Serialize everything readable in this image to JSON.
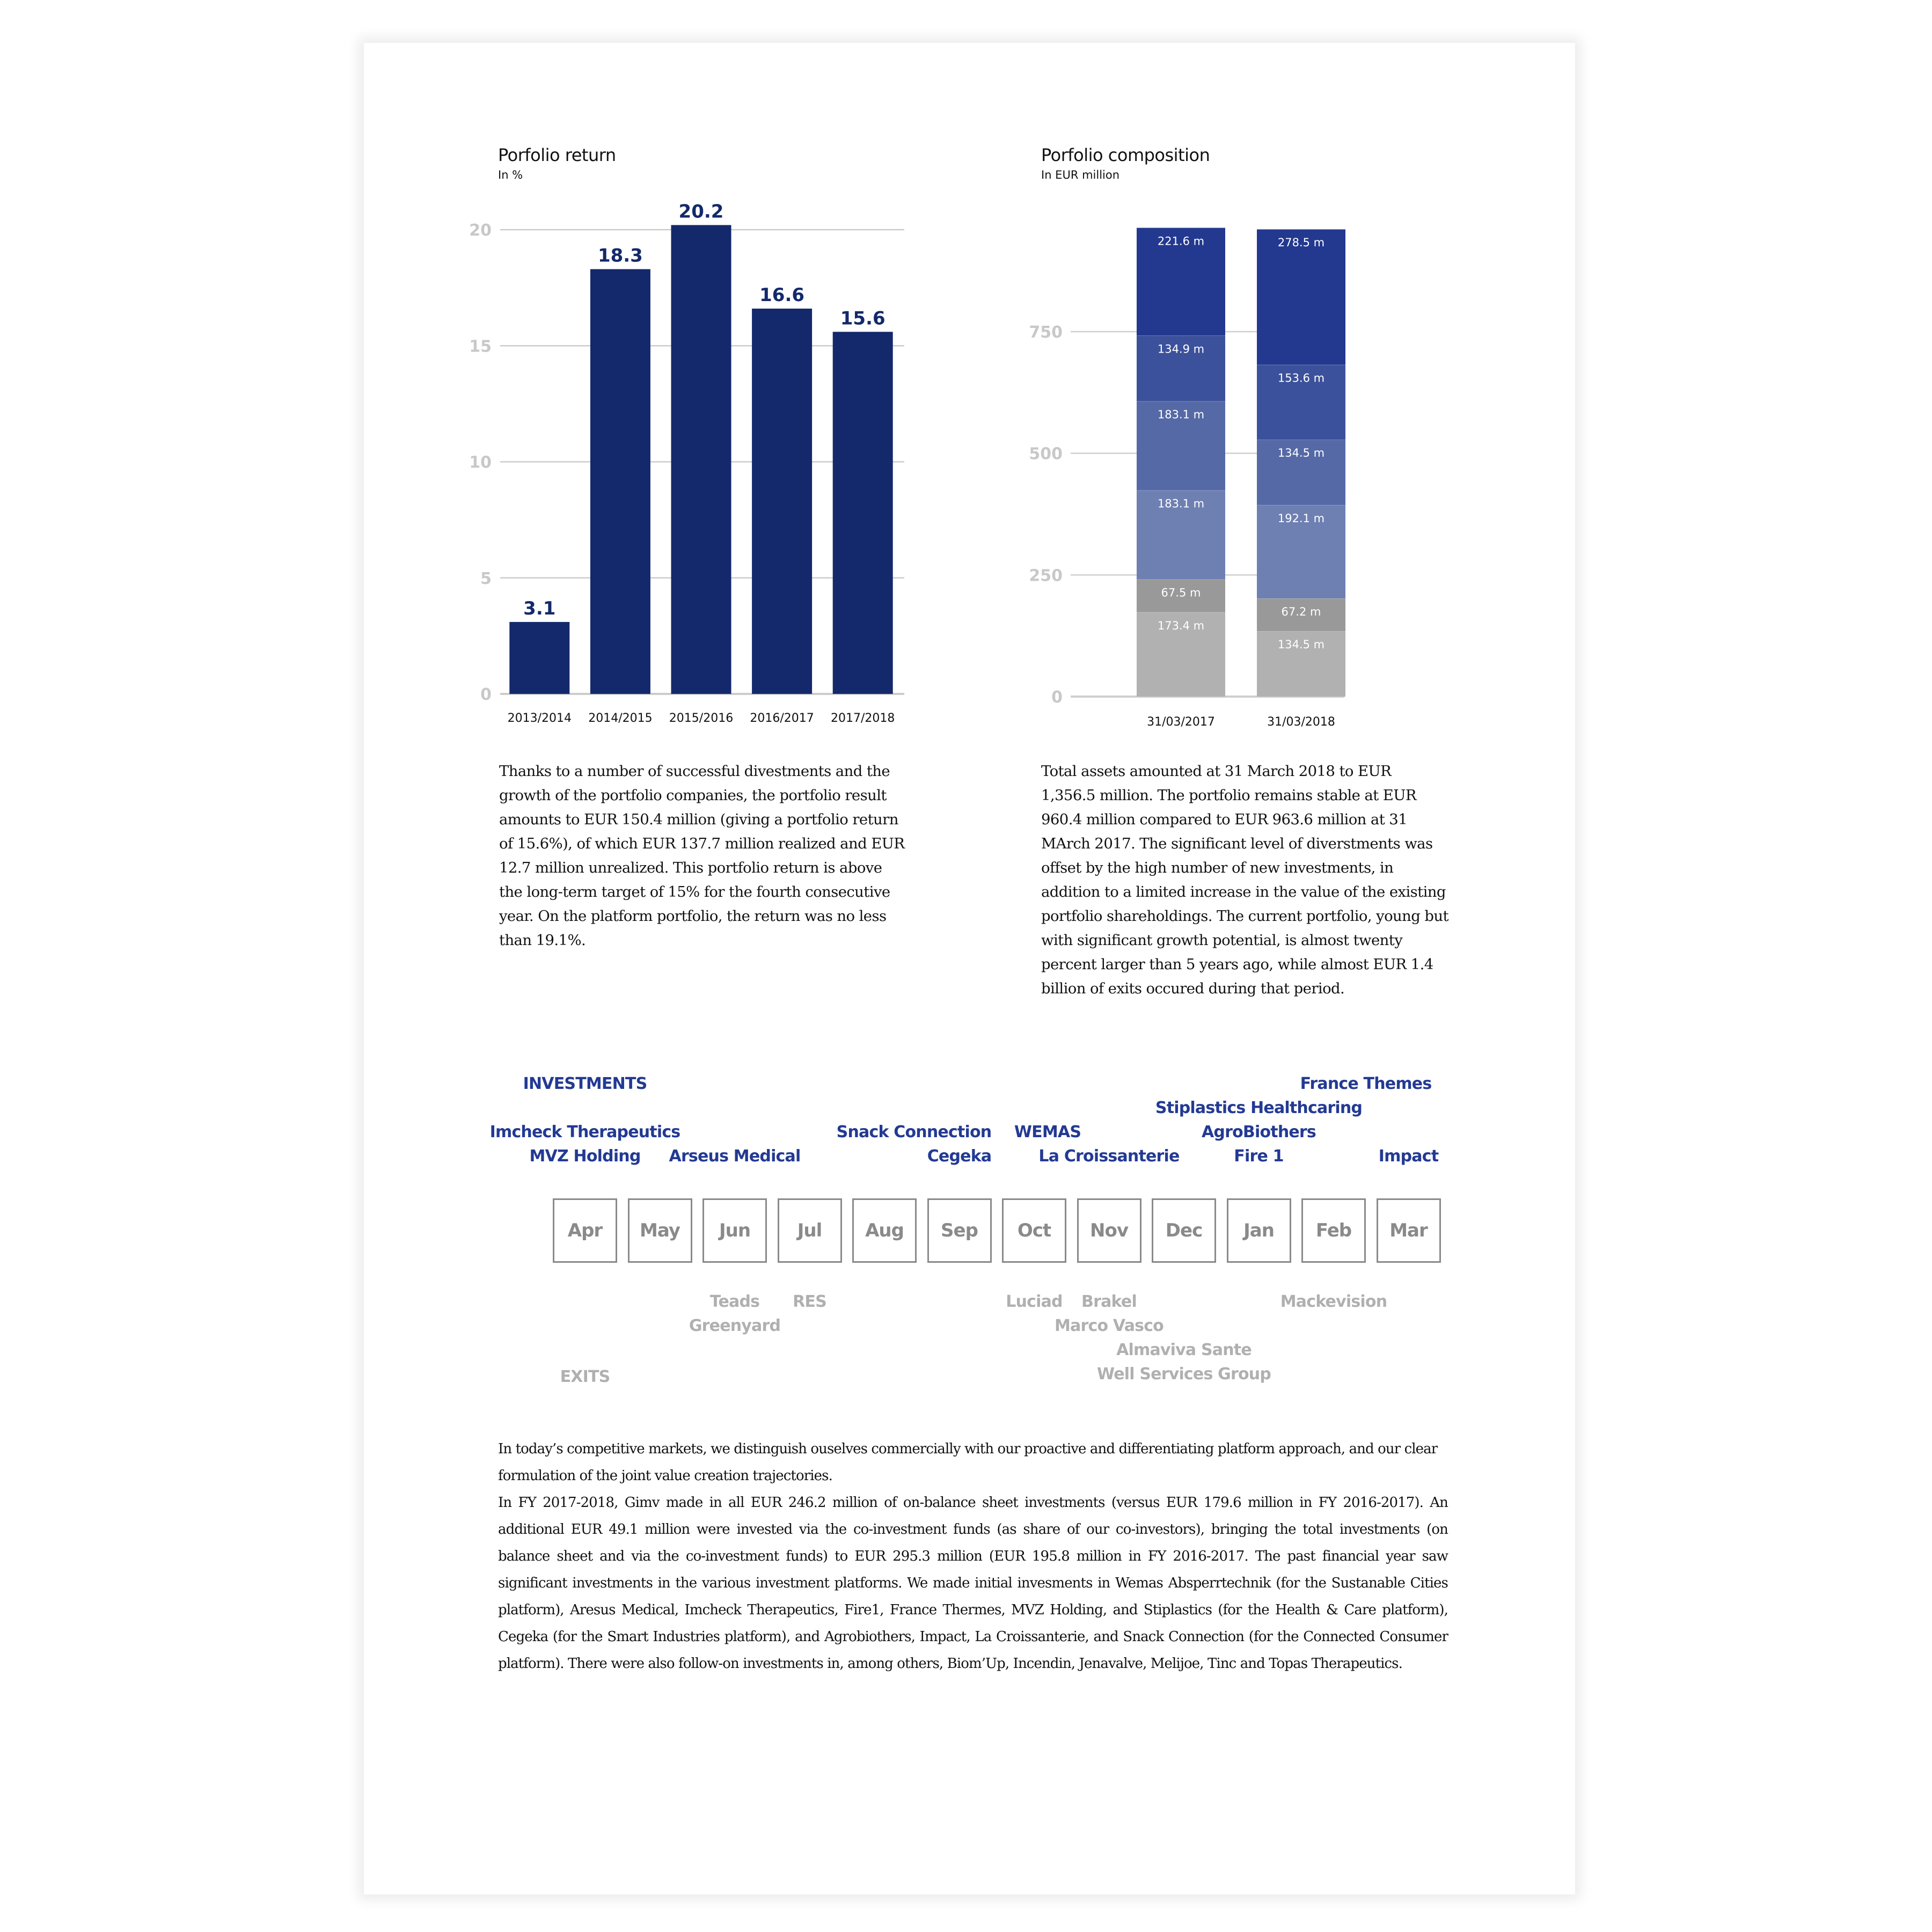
{
  "chart_data": [
    {
      "type": "bar",
      "title": "Porfolio return",
      "subtitle": "In %",
      "xlabel": "",
      "ylabel": "",
      "categories": [
        "2013/2014",
        "2014/2015",
        "2015/2016",
        "2016/2017",
        "2017/2018"
      ],
      "values": [
        3.1,
        18.3,
        20.2,
        16.6,
        15.6
      ],
      "value_labels": [
        "3.1",
        "18.3",
        "20.2",
        "16.6",
        "15.6"
      ],
      "ylim": [
        0,
        20
      ],
      "yticks": [
        0,
        5,
        10,
        15,
        20
      ],
      "grid": true,
      "legend": "none",
      "colors": {
        "bar": "#13296b",
        "label": "#13296b",
        "grid": "#cccccc",
        "tick": "#c8c8c8"
      }
    },
    {
      "type": "bar",
      "stacked": true,
      "title": "Porfolio composition",
      "subtitle": "In EUR million",
      "xlabel": "",
      "ylabel": "",
      "categories": [
        "31/03/2017",
        "31/03/2018"
      ],
      "series": [
        {
          "name": "segment-1",
          "color": "#b1b1b1",
          "values": [
            173.4,
            134.5
          ],
          "labels": [
            "173.4 m",
            "134.5 m"
          ]
        },
        {
          "name": "segment-2",
          "color": "#999999",
          "values": [
            67.5,
            67.2
          ],
          "labels": [
            "67.5 m",
            "67.2 m"
          ]
        },
        {
          "name": "segment-3",
          "color": "#6e7fb2",
          "values": [
            183.1,
            192.1
          ],
          "labels": [
            "183.1 m",
            "192.1 m"
          ]
        },
        {
          "name": "segment-4",
          "color": "#5569a6",
          "values": [
            183.1,
            134.5
          ],
          "labels": [
            "183.1 m",
            "134.5 m"
          ]
        },
        {
          "name": "segment-5",
          "color": "#3c519b",
          "values": [
            134.9,
            153.6
          ],
          "labels": [
            "134.9 m",
            "153.6 m"
          ]
        },
        {
          "name": "segment-6",
          "color": "#23388f",
          "values": [
            221.6,
            278.5
          ],
          "labels": [
            "221.6 m",
            "278.5 m"
          ]
        }
      ],
      "ylim": [
        0,
        963.6
      ],
      "yticks": [
        0,
        250,
        500,
        750
      ],
      "grid": true,
      "legend": "none"
    }
  ],
  "left_text": "Thanks to a number of successful divestments and the growth of the portfolio companies, the portfolio result amounts to EUR 150.4 million (giving a portfolio return of 15.6%), of which EUR 137.7 million realized and EUR 12.7 million unrealized. This portfolio return is above the long-term target of 15% for the fourth consecutive year. On the platform portfolio, the return was no less than 19.1%.",
  "right_text": "Total assets amounted at 31 March 2018 to EUR 1,356.5 million. The portfolio remains stable at EUR 960.4 million compared to EUR 963.6 million at 31 MArch 2017. The significant level of diverstments was offset by the high number of new investments, in addition to a limited increase in the value of the existing portfolio shareholdings. The current portfolio, young but with significant growth potential, is almost twenty percent larger than 5 years ago, while almost EUR 1.4 billion of exits occured during that period.",
  "timeline": {
    "investments_heading": "INVESTMENTS",
    "exits_heading": "EXITS",
    "months": [
      "Apr",
      "May",
      "Jun",
      "Jul",
      "Aug",
      "Sep",
      "Oct",
      "Nov",
      "Dec",
      "Jan",
      "Feb",
      "Mar"
    ],
    "investments": [
      {
        "name": "Imcheck Therapeutics",
        "month": "Apr"
      },
      {
        "name": "MVZ Holding",
        "month": "Apr"
      },
      {
        "name": "Arseus Medical",
        "month": "Jun"
      },
      {
        "name": "Snack Connection",
        "month": "Aug"
      },
      {
        "name": "Cegeka",
        "month": "Sep"
      },
      {
        "name": "WEMAS",
        "month": "Oct"
      },
      {
        "name": "La Croissanterie",
        "month": "Nov"
      },
      {
        "name": "Stiplastics Healthcaring",
        "month": "Jan"
      },
      {
        "name": "AgroBiothers",
        "month": "Jan"
      },
      {
        "name": "Fire 1",
        "month": "Jan"
      },
      {
        "name": "France Themes",
        "month": "Feb"
      },
      {
        "name": "Impact",
        "month": "Mar"
      }
    ],
    "exits": [
      {
        "name": "Teads",
        "month": "Jun"
      },
      {
        "name": "Greenyard",
        "month": "Jun"
      },
      {
        "name": "RES",
        "month": "Jul"
      },
      {
        "name": "Luciad",
        "month": "Oct"
      },
      {
        "name": "Brakel",
        "month": "Nov"
      },
      {
        "name": "Marco Vasco",
        "month": "Nov"
      },
      {
        "name": "Almaviva Sante",
        "month": "Dec"
      },
      {
        "name": "Well Services Group",
        "month": "Dec"
      },
      {
        "name": "Mackevision",
        "month": "Feb"
      }
    ]
  },
  "bottom_text": {
    "p1": "In today’s competitive markets, we distinguish ouselves commercially with our proactive and differentiating platform approach, and our clear formulation of the joint value creation trajectories.",
    "p2": "In FY 2017-2018, Gimv made in all EUR 246.2 million of on-balance sheet investments (versus EUR 179.6 million in FY 2016-2017). An additional EUR 49.1 million were invested via the co-investment funds (as share of our co-investors), bringing the total investments (on balance sheet and via the co-investment funds) to EUR 295.3 million (EUR 195.8 million in FY 2016-2017. The past financial year saw significant investments in the various investment platforms. We made initial invesments in Wemas Absperrtechnik (for the Sustanable Cities platform), Aresus Medical, Imcheck Therapeutics, Fire1, France Thermes, MVZ Holding, and Stiplastics (for the Health & Care platform), Cegeka (for the Smart Industries platform), and Agrobiothers, Impact, La Croissanterie, and Snack Connection (for the Connected Consumer platform). There were also follow-on investments in, among others, Biom’Up, Incendin, Jenavalve, Melijoe, Tinc and Topas Therapeutics."
  },
  "colors": {
    "brand_blue": "#233a93",
    "exit_grey": "#b0b0b0",
    "month_grey": "#8a8a8a"
  }
}
